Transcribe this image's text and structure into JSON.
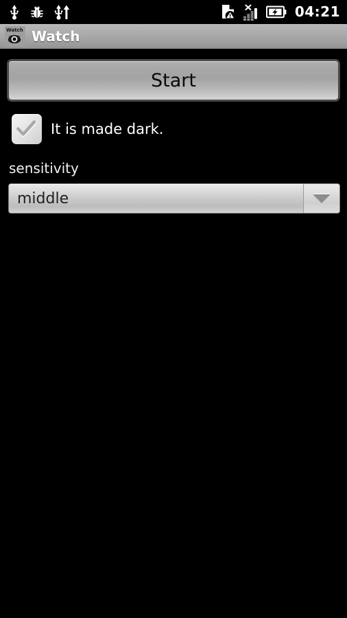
{
  "status_bar": {
    "left_icons": [
      {
        "name": "usb-icon",
        "label": "USB connected"
      },
      {
        "name": "bug-icon",
        "label": "USB debugging enabled"
      },
      {
        "name": "usb-transfer-icon",
        "label": "USB data transfer"
      }
    ],
    "right_icons": [
      {
        "name": "sdcard-warning-icon",
        "label": "SD card warning"
      },
      {
        "name": "signal-no-service-icon",
        "label": "No mobile signal"
      },
      {
        "name": "battery-charging-icon",
        "label": "Battery charging"
      }
    ],
    "clock": "04:21",
    "background": "#000000",
    "foreground": "#ffffff"
  },
  "title_bar": {
    "app_icon_label": "Watch",
    "title": "Watch"
  },
  "main": {
    "start_button": {
      "label": "Start"
    },
    "dark_checkbox": {
      "label": "It is made dark.",
      "checked": true
    },
    "sensitivity": {
      "label": "sensitivity",
      "selected": "middle",
      "options": [
        "middle"
      ]
    }
  },
  "colors": {
    "screen_background": "#000000",
    "title_bar_top": "#b9b9b9",
    "title_bar_bottom": "#8f8f8f",
    "button_face": "#a8a8a8",
    "button_border": "#4a4a4a",
    "text_light": "#ffffff",
    "text_dark": "#0a0a0a"
  }
}
